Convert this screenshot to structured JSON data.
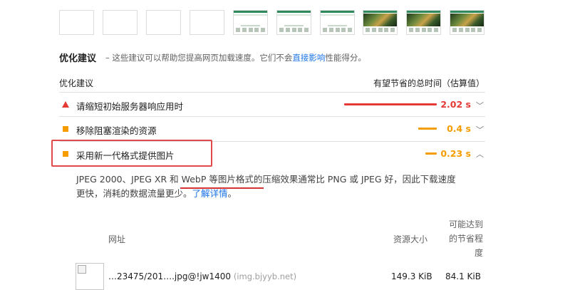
{
  "filmstrip": [
    {
      "kind": "blank"
    },
    {
      "kind": "blank"
    },
    {
      "kind": "blank"
    },
    {
      "kind": "blank"
    },
    {
      "kind": "page"
    },
    {
      "kind": "page"
    },
    {
      "kind": "page"
    },
    {
      "kind": "banner"
    },
    {
      "kind": "banner"
    },
    {
      "kind": "banner"
    }
  ],
  "section": {
    "title": "优化建议",
    "desc_prefix": "– 这些建议可以帮助您提高网页加载速度。它们不会",
    "desc_link": "直接影响",
    "desc_suffix": "性能得分。"
  },
  "columns": {
    "left": "优化建议",
    "right": "有望节省的总时间（估算值）"
  },
  "audits": [
    {
      "label": "请缩短初始服务器响应用时",
      "value": "2.02 s",
      "severity": "fail",
      "severity_color": "#e53935",
      "expanded": false,
      "chevron": "﹀",
      "savings_fraction": 1.0
    },
    {
      "label": "移除阻塞渲染的资源",
      "value": "0.4 s",
      "severity": "average",
      "severity_color": "#f59c00",
      "expanded": false,
      "chevron": "﹀",
      "savings_fraction": 0.2
    },
    {
      "label": "采用新一代格式提供图片",
      "value": "0.23 s",
      "severity": "average",
      "severity_color": "#f59c00",
      "expanded": true,
      "chevron": "︿",
      "savings_fraction": 0.12
    }
  ],
  "details": {
    "line1": "JPEG 2000、JPEG XR 和 WebP 等图片格式的压缩效果通常比 PNG 或 JPEG 好，因此下载速度",
    "line2_prefix": "更快，消耗的数据流量更少。",
    "link": "了解详情",
    "line2_suffix": "。"
  },
  "table": {
    "headers": {
      "url": "网址",
      "size": "资源大小",
      "savings_l1": "可能达到",
      "savings_l2": "的节省程",
      "savings_l3": "度"
    },
    "rows": [
      {
        "url": "…23475/201….jpg@!jw1400",
        "host": "(img.bjyyb.net)",
        "size": "149.3 KiB",
        "savings": "84.1 KiB"
      }
    ]
  }
}
